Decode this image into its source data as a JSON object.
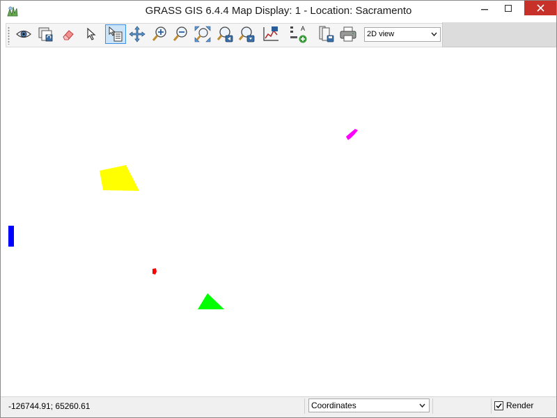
{
  "window": {
    "title": "GRASS GIS 6.4.4 Map Display: 1  - Location: Sacramento"
  },
  "toolbar": {
    "tools": [
      {
        "name": "display-map-icon",
        "active": false
      },
      {
        "name": "render-map-icon",
        "active": false
      },
      {
        "name": "erase-display-icon",
        "active": false
      },
      {
        "name": "pointer-icon",
        "active": false
      },
      {
        "name": "query-icon",
        "active": true
      },
      {
        "name": "pan-icon",
        "active": false
      },
      {
        "name": "zoom-in-icon",
        "active": false
      },
      {
        "name": "zoom-out-icon",
        "active": false
      },
      {
        "name": "zoom-extent-icon",
        "active": false
      },
      {
        "name": "zoom-back-icon",
        "active": false
      },
      {
        "name": "zoom-menu-icon",
        "active": false
      },
      {
        "name": "analyze-icon",
        "active": false
      },
      {
        "name": "decoration-icon",
        "active": false
      },
      {
        "name": "save-image-icon",
        "active": false
      },
      {
        "name": "print-icon",
        "active": false
      }
    ],
    "view_mode": {
      "selected": "2D view"
    }
  },
  "map": {
    "features": [
      {
        "name": "yellow-polygon",
        "color": "#ffff00"
      },
      {
        "name": "magenta-feature",
        "color": "#ff00ff"
      },
      {
        "name": "blue-feature",
        "color": "#0000ff"
      },
      {
        "name": "red-feature",
        "color": "#ff0000"
      },
      {
        "name": "green-triangle",
        "color": "#00ff00"
      }
    ]
  },
  "statusbar": {
    "coordinates": "-126744.91; 65260.61",
    "mode_selected": "Coordinates",
    "render_label": "Render",
    "render_checked": true
  },
  "colors": {
    "close_button": "#c7312a",
    "active_tool_bg": "#cce4f7",
    "active_tool_border": "#3d8ee0"
  }
}
